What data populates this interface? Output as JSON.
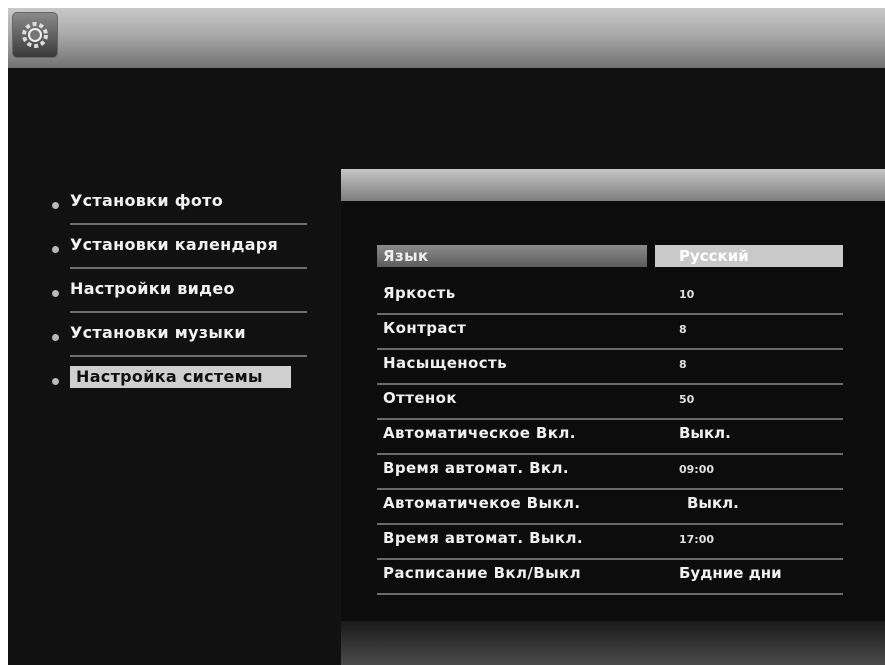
{
  "header": {
    "icon": "settings-gear-icon"
  },
  "menu": {
    "items": [
      {
        "label": "Установки фото"
      },
      {
        "label": "Установки календаря"
      },
      {
        "label": "Настройки видео"
      },
      {
        "label": "Установки музыки"
      },
      {
        "label": "Настройка системы",
        "selected": true
      }
    ]
  },
  "settings": {
    "rows": [
      {
        "label": "Язык",
        "value": "Русский",
        "selected": true
      },
      {
        "label": "Яркость",
        "value": "10"
      },
      {
        "label": "Контраст",
        "value": "8"
      },
      {
        "label": "Насыщеность",
        "value": "8"
      },
      {
        "label": "Оттенок",
        "value": "50"
      },
      {
        "label": "Автоматическое Вкл.",
        "value": "Выкл."
      },
      {
        "label": "Время автомат. Вкл.",
        "value": "09:00"
      },
      {
        "label": "Автоматичекое Выкл.",
        "value": "Выкл."
      },
      {
        "label": "Время автомат. Выкл.",
        "value": "17:00"
      },
      {
        "label": "Расписание Вкл/Выкл",
        "value": "Будние дни"
      }
    ]
  }
}
